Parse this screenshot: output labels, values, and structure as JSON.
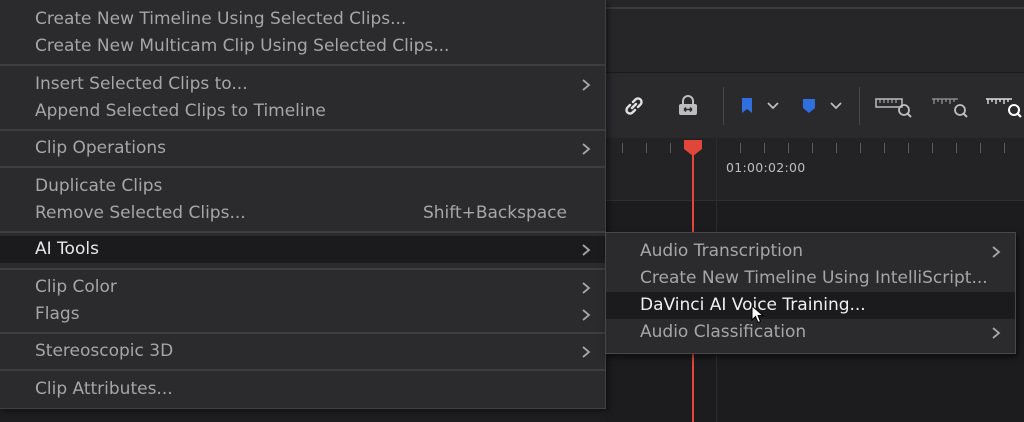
{
  "menu": {
    "items": [
      {
        "label": "Create New Timeline Using Selected Clips...",
        "shortcut": "",
        "submenu": false
      },
      {
        "label": "Create New Multicam Clip Using Selected Clips...",
        "shortcut": "",
        "submenu": false
      },
      {
        "label": "Insert Selected Clips to...",
        "shortcut": "",
        "submenu": true
      },
      {
        "label": "Append Selected Clips to Timeline",
        "shortcut": "",
        "submenu": false
      },
      {
        "label": "Clip Operations",
        "shortcut": "",
        "submenu": true
      },
      {
        "label": "Duplicate Clips",
        "shortcut": "",
        "submenu": false
      },
      {
        "label": "Remove Selected Clips...",
        "shortcut": "Shift+Backspace",
        "submenu": false
      },
      {
        "label": "AI Tools",
        "shortcut": "",
        "submenu": true,
        "active": true
      },
      {
        "label": "Clip Color",
        "shortcut": "",
        "submenu": true
      },
      {
        "label": "Flags",
        "shortcut": "",
        "submenu": true
      },
      {
        "label": "Stereoscopic 3D",
        "shortcut": "",
        "submenu": true
      },
      {
        "label": "Clip Attributes...",
        "shortcut": "",
        "submenu": false
      }
    ]
  },
  "submenu": {
    "items": [
      {
        "label": "Audio Transcription",
        "submenu": true
      },
      {
        "label": "Create New Timeline Using IntelliScript...",
        "submenu": false
      },
      {
        "label": "DaVinci AI Voice Training...",
        "submenu": false,
        "active": true
      },
      {
        "label": "Audio Classification",
        "submenu": true
      }
    ]
  },
  "timeline": {
    "timecode": "01:00:02:00"
  },
  "toolbar": {
    "icons": [
      "link-icon",
      "lock-icon",
      "blue-flag-icon",
      "blue-marker-icon",
      "zoom-full-icon",
      "zoom-detail-icon",
      "zoom-custom-icon"
    ]
  },
  "colors": {
    "playhead": "#e0463a",
    "flag": "#2f6fe0",
    "marker": "#2f6fe0"
  }
}
